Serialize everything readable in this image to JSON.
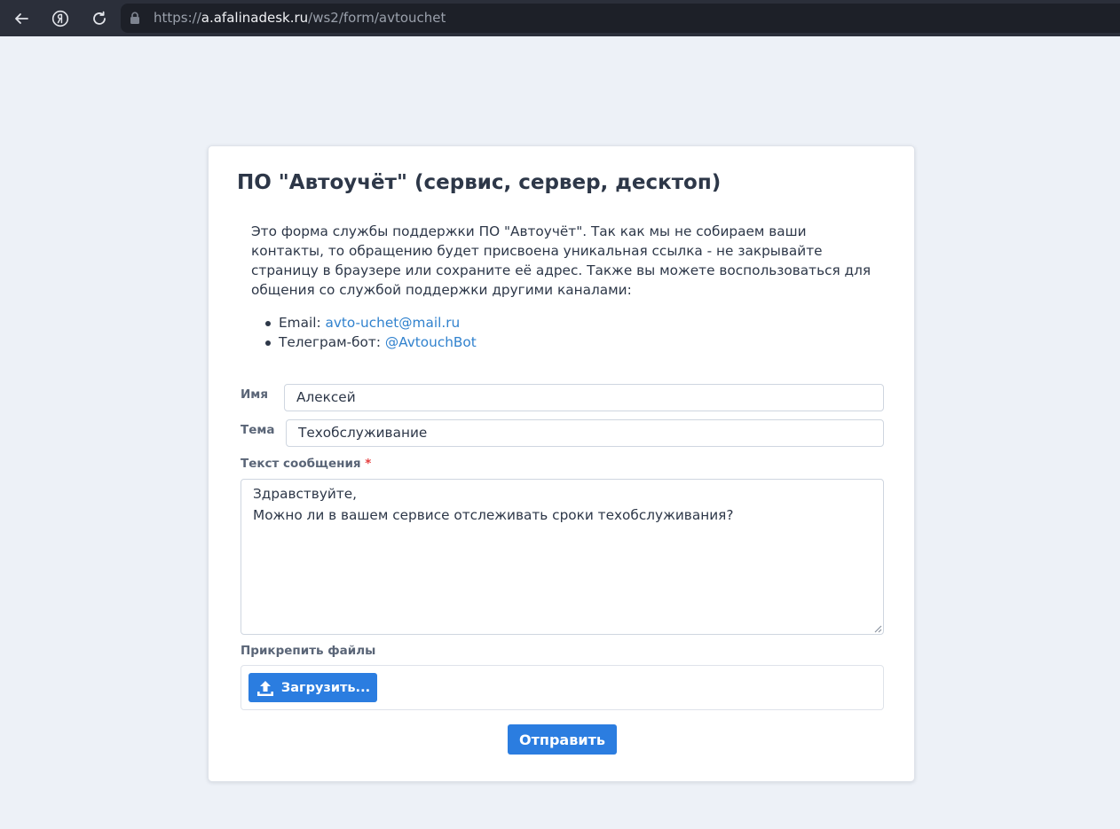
{
  "browser": {
    "url_scheme": "https://",
    "url_host": "a.afalinadesk.ru",
    "url_path": "/ws2/form/avtouchet",
    "colors": {
      "bar": "#2b2f3a",
      "url_field": "#1d2028"
    }
  },
  "form": {
    "title": "ПО \"Автоучёт\" (сервис, сервер, десктоп)",
    "intro": "Это форма службы поддержки ПО \"Автоучёт\". Так как мы не собираем ваши контакты, то обращению будет присвоена уникальная ссылка - не закрывайте страницу в браузере или сохраните её адрес. Также вы можете воспользоваться для общения со службой поддержки другими каналами:",
    "contacts": [
      {
        "label": "Email: ",
        "link": "avto-uchet@mail.ru"
      },
      {
        "label": "Телеграм-бот: ",
        "link": "@AvtouchBot"
      }
    ],
    "fields": {
      "name": {
        "label": "Имя",
        "value": "Алексей"
      },
      "subject": {
        "label": "Тема",
        "value": "Техобслуживание"
      },
      "message": {
        "label": "Текст сообщения",
        "required_mark": "*",
        "lines": [
          "Здравствуйте,",
          "Можно ли в вашем сервисе отслеживать сроки техобслуживания?"
        ]
      }
    },
    "attachments": {
      "label": "Прикрепить файлы",
      "upload_label": "Загрузить..."
    },
    "submit_label": "Отправить",
    "colors": {
      "accent": "#2b7de0",
      "link": "#3182ce",
      "required": "#e53e3e",
      "page_bg": "#edf1f7"
    }
  }
}
